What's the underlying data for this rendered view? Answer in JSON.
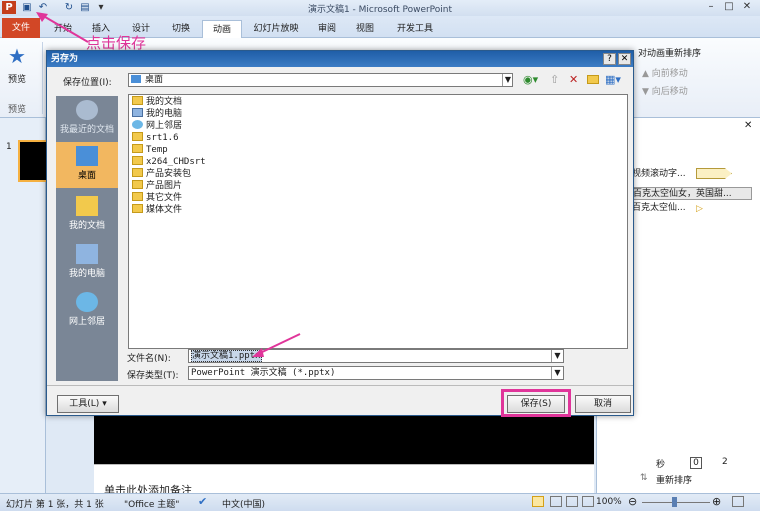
{
  "app": {
    "title": "演示文稿1 - Microsoft PowerPoint"
  },
  "tabs": [
    "文件",
    "开始",
    "插入",
    "设计",
    "切换",
    "动画",
    "幻灯片放映",
    "审阅",
    "视图",
    "开发工具"
  ],
  "ribbon": {
    "preview_label": "预览",
    "preview_group": "预览",
    "reorder_title": "对动画重新排序",
    "move_earlier": "向前移动",
    "move_later": "向后移动"
  },
  "annotations": {
    "save_hint": "点击保存"
  },
  "left_pane": {
    "slide_number": "1"
  },
  "right_pane": {
    "items": [
      "视频滚动字...",
      "百克太空仙女，英国甜...",
      "百克太空仙..."
    ],
    "seconds_label": "秒",
    "page_value": "0",
    "page_max": "2",
    "reorder_label": "重新排序"
  },
  "notes": {
    "placeholder": "单击此处添加备注"
  },
  "status": {
    "slide_info": "幻灯片 第 1 张，共 1 张",
    "theme": "\"Office 主题\"",
    "language": "中文(中国)",
    "zoom": "100%"
  },
  "dialog": {
    "title": "另存为",
    "save_in_label": "保存位置(I):",
    "save_in_value": "桌面",
    "places": [
      {
        "label": "我最近的文档",
        "icon": "recent-docs-icon"
      },
      {
        "label": "桌面",
        "icon": "desktop-icon"
      },
      {
        "label": "我的文档",
        "icon": "my-documents-icon"
      },
      {
        "label": "我的电脑",
        "icon": "my-computer-icon"
      },
      {
        "label": "网上邻居",
        "icon": "network-icon"
      }
    ],
    "files": [
      "我的文档",
      "我的电脑",
      "网上邻居",
      "srt1.6",
      "Temp",
      "x264_CHDsrt",
      "产品安装包",
      "产品图片",
      "其它文件",
      "媒体文件"
    ],
    "filename_label": "文件名(N):",
    "filename_value": "演示文稿1.pptx",
    "filetype_label": "保存类型(T):",
    "filetype_value": "PowerPoint 演示文稿 (*.pptx)",
    "tools_label": "工具(L)",
    "save_label": "保存(S)",
    "cancel_label": "取消"
  },
  "colors": {
    "accent": "#e0359a",
    "file_tab": "#d24726",
    "dialog_title": "#1f5ea8"
  }
}
